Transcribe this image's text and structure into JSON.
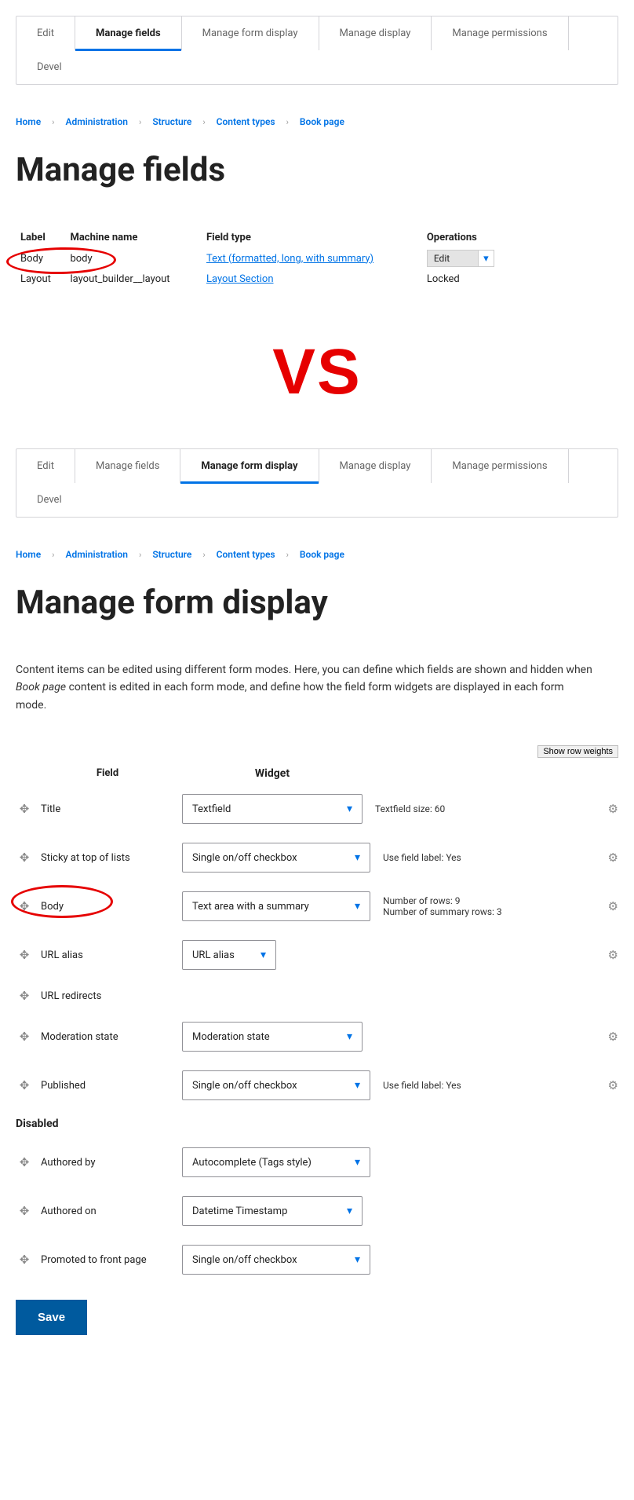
{
  "section1": {
    "tabs": [
      "Edit",
      "Manage fields",
      "Manage form display",
      "Manage display",
      "Manage permissions",
      "Devel"
    ],
    "active_tab": "Manage fields",
    "breadcrumb": [
      "Home",
      "Administration",
      "Structure",
      "Content types",
      "Book page"
    ],
    "page_title": "Manage fields",
    "table": {
      "headers": [
        "Label",
        "Machine name",
        "Field type",
        "Operations"
      ],
      "rows": [
        {
          "label": "Body",
          "machine": "body",
          "type": "Text (formatted, long, with summary)",
          "op": "Edit"
        },
        {
          "label": "Layout",
          "machine": "layout_builder__layout",
          "type": "Layout Section",
          "op": "Locked"
        }
      ]
    }
  },
  "vs_text": "VS",
  "section2": {
    "tabs": [
      "Edit",
      "Manage fields",
      "Manage form display",
      "Manage display",
      "Manage permissions",
      "Devel"
    ],
    "active_tab": "Manage form display",
    "breadcrumb": [
      "Home",
      "Administration",
      "Structure",
      "Content types",
      "Book page"
    ],
    "page_title": "Manage form display",
    "intro_pre": "Content items can be edited using different form modes. Here, you can define which fields are shown and hidden when ",
    "intro_em": "Book page",
    "intro_post": " content is edited in each form mode, and define how the field form widgets are displayed in each form mode.",
    "show_weights": "Show row weights",
    "col_field": "Field",
    "col_widget": "Widget",
    "disabled_header": "Disabled",
    "rows": [
      {
        "field": "Title",
        "widget": "Textfield",
        "summary": "Textfield size: 60",
        "gear": true,
        "width": "normal"
      },
      {
        "field": "Sticky at top of lists",
        "widget": "Single on/off checkbox",
        "summary": "Use field label: Yes",
        "gear": true,
        "width": "wide"
      },
      {
        "field": "Body",
        "widget": "Text area with a summary",
        "summary": "Number of rows: 9\nNumber of summary rows: 3",
        "gear": true,
        "width": "wide"
      },
      {
        "field": "URL alias",
        "widget": "URL alias",
        "summary": "",
        "gear": true,
        "width": "narrow"
      },
      {
        "field": "URL redirects",
        "widget": "",
        "summary": "",
        "gear": false,
        "width": ""
      },
      {
        "field": "Moderation state",
        "widget": "Moderation state",
        "summary": "",
        "gear": true,
        "width": "normal"
      },
      {
        "field": "Published",
        "widget": "Single on/off checkbox",
        "summary": "Use field label: Yes",
        "gear": true,
        "width": "wide"
      }
    ],
    "disabled_rows": [
      {
        "field": "Authored by",
        "widget": "Autocomplete (Tags style)",
        "width": "wide"
      },
      {
        "field": "Authored on",
        "widget": "Datetime Timestamp",
        "width": "normal"
      },
      {
        "field": "Promoted to front page",
        "widget": "Single on/off checkbox",
        "width": "wide"
      }
    ],
    "save": "Save"
  }
}
